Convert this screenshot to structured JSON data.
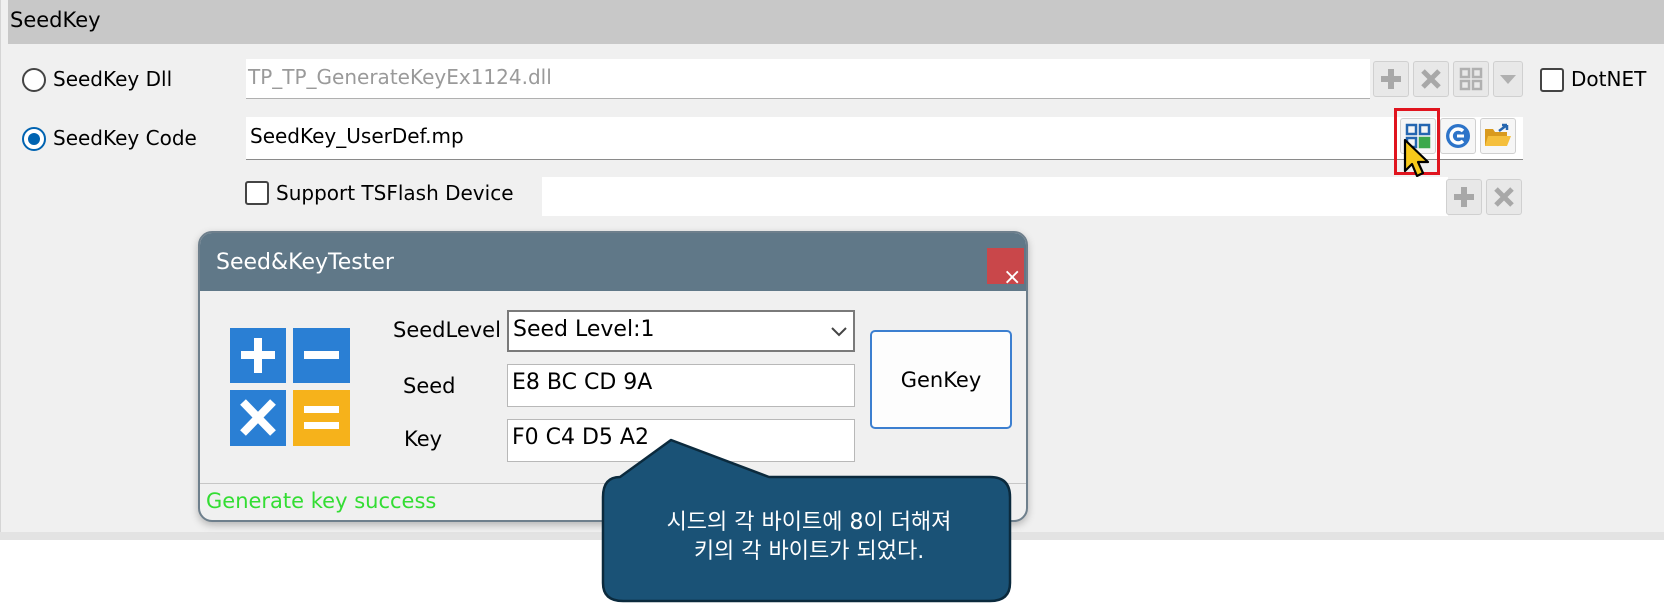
{
  "panel": {
    "title": "SeedKey",
    "dll_option_label": "SeedKey Dll",
    "dll_path": "TP_TP_GenerateKeyEx1124.dll",
    "dotnet_label": "DotNET",
    "code_option_label": "SeedKey Code",
    "code_file": "SeedKey_UserDef.mp",
    "tsflash_label": "Support TSFlash Device",
    "tsflash_value": ""
  },
  "dialog": {
    "title": "Seed&KeyTester",
    "close_symbol": "×",
    "seed_level_label": "SeedLevel",
    "seed_level_value": "Seed Level:1",
    "seed_label": "Seed",
    "seed_value": "E8 BC CD 9A",
    "key_label": "Key",
    "key_value": "F0 C4 D5 A2",
    "genkey_label": "GenKey",
    "status": "Generate key success"
  },
  "callout": {
    "line1": "시드의 각 바이트에 8이 더해져",
    "line2": "키의 각 바이트가 되었다."
  },
  "colors": {
    "accent": "#0063b1",
    "dialog_title_bar": "#607888",
    "status_green": "#33dd33",
    "callout_fill": "#1a5276",
    "highlight": "#e0141e"
  },
  "icons": [
    "plus-icon",
    "close-icon",
    "grid-icon",
    "dropdown-icon",
    "code-icon",
    "folder-open-icon",
    "calculator-icon",
    "cursor-icon"
  ]
}
